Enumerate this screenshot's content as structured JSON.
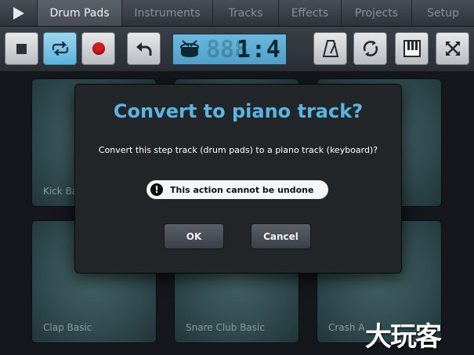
{
  "tabs": {
    "drum_pads": "Drum Pads",
    "instruments": "Instruments",
    "tracks": "Tracks",
    "effects": "Effects",
    "projects": "Projects",
    "setup": "Setup",
    "active": "Drum Pads"
  },
  "toolbar": {
    "position_display": "1:4",
    "icons": [
      "stop-icon",
      "loop-icon",
      "record-icon",
      "undo-icon",
      "drum-icon",
      "metronome-icon",
      "sync-icon",
      "piano-keys-icon",
      "fullscreen-icon"
    ]
  },
  "pads": [
    {
      "label": "Kick Basic"
    },
    {
      "label": ""
    },
    {
      "label": ""
    },
    {
      "label": "Clap Basic"
    },
    {
      "label": "Snare Club Basic"
    },
    {
      "label": "Crash A"
    }
  ],
  "dialog": {
    "title": "Convert to piano track?",
    "message": "Convert this step track (drum pads) to a piano track (keyboard)?",
    "warning": "This action cannot be undone",
    "ok_label": "OK",
    "cancel_label": "Cancel"
  },
  "watermark": "大玩客",
  "colors": {
    "dialog_title": "#59b6e2",
    "record": "#d31c1c",
    "lcd": "#5fb0d8",
    "pad": "#4e777c"
  }
}
